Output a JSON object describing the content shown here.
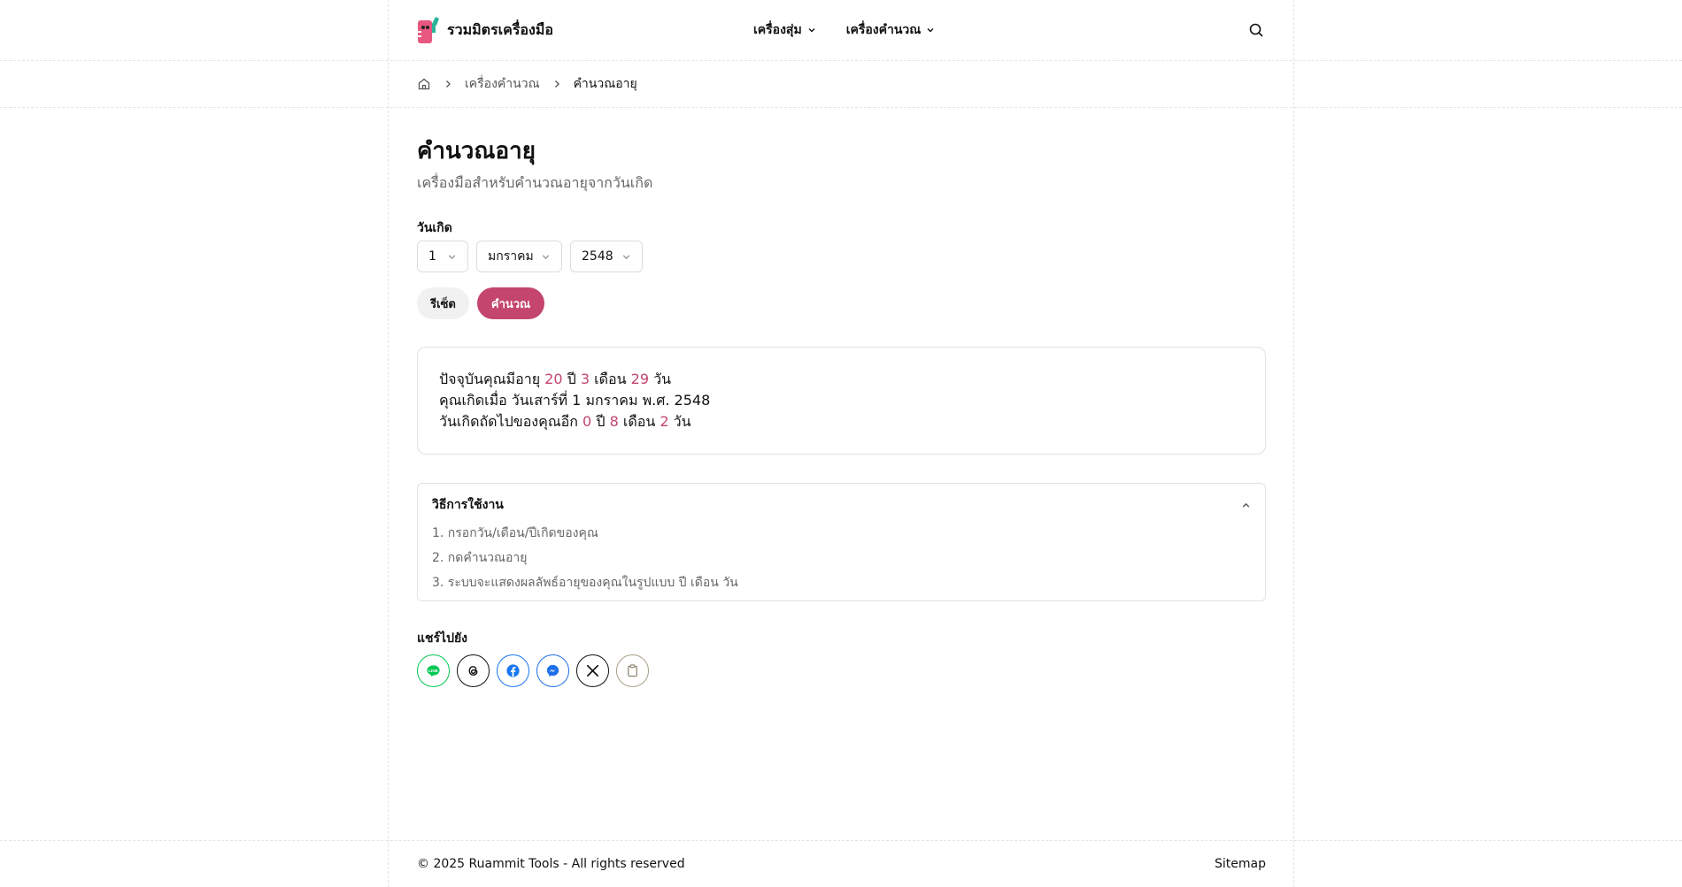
{
  "header": {
    "brand_name": "รวมมิตรเครื่องมือ",
    "nav": [
      {
        "label": "เครื่องสุ่ม"
      },
      {
        "label": "เครื่องคำนวณ"
      }
    ]
  },
  "breadcrumb": {
    "items": [
      "เครื่องคำนวณ",
      "คำนวณอายุ"
    ]
  },
  "main": {
    "title": "คำนวณอายุ",
    "description": "เครื่องมือสำหรับคำนวณอายุจากวันเกิด",
    "birthdate_label": "วันเกิด",
    "day": "1",
    "month": "มกราคม",
    "year": "2548",
    "reset_label": "รีเซ็ต",
    "calc_label": "คำนวณ"
  },
  "result": {
    "line1_prefix": "ปัจจุบันคุณมีอายุ",
    "age_years": "20",
    "unit_year": "ปี",
    "age_months": "3",
    "unit_month": "เดือน",
    "age_days": "29",
    "unit_day": "วัน",
    "line2": "คุณเกิดเมื่อ วันเสาร์ที่ 1 มกราคม พ.ศ. 2548",
    "line3_prefix": "วันเกิดถัดไปของคุณอีก",
    "next_years": "0",
    "next_months": "8",
    "next_days": "2"
  },
  "howto": {
    "title": "วิธีการใช้งาน",
    "steps": [
      "1. กรอกวัน/เดือน/ปีเกิดของคุณ",
      "2. กดคำนวณอายุ",
      "3. ระบบจะแสดงผลลัพธ์อายุของคุณในรูปแบบ ปี เดือน วัน"
    ]
  },
  "share": {
    "label": "แชร์ไปยัง",
    "icons": [
      "line-icon",
      "threads-icon",
      "facebook-icon",
      "messenger-icon",
      "x-icon",
      "clipboard-icon"
    ]
  },
  "footer": {
    "copyright": "© 2025 Ruammit Tools - All rights reserved",
    "sitemap": "Sitemap"
  },
  "colors": {
    "accent": "#c4456d",
    "line": "#06c755",
    "facebook": "#1877f2",
    "messenger": "#1e6fe8"
  }
}
